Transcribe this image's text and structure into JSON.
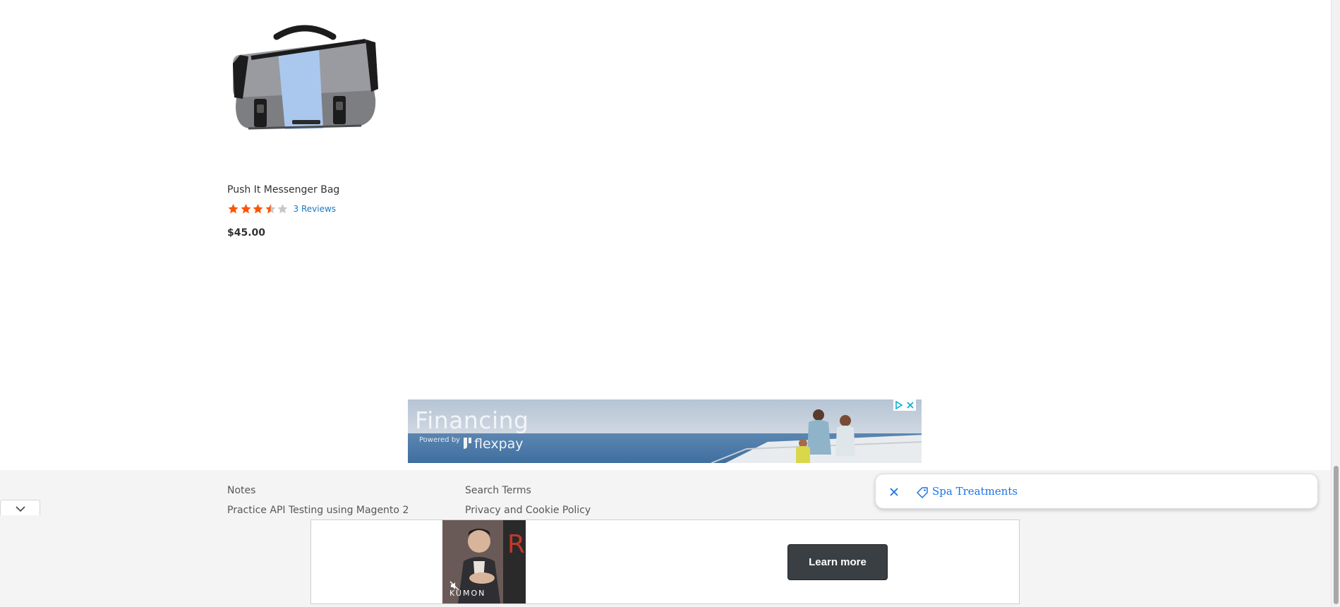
{
  "product": {
    "name": "Push It Messenger Bag",
    "rating": 3.5,
    "rating_max": 5,
    "reviews_label": "3 Reviews",
    "price": "$45.00"
  },
  "banner_ad": {
    "title": "Financing",
    "powered_by": "Powered by",
    "brand": "flexpay"
  },
  "footer": {
    "links": [
      "Notes",
      "Practice API Testing using Magento 2",
      "Search Terms",
      "Privacy and Cookie Policy"
    ]
  },
  "notification": {
    "label": "Spa Treatments"
  },
  "bottom_ad": {
    "video_brand": "KUMON",
    "cta_label": "Learn more"
  },
  "colors": {
    "star_filled": "#ff5501",
    "star_empty": "#c7c7c7",
    "link": "#1979c3",
    "notification_text": "#1a73e8",
    "cta_bg": "#3a3f44"
  }
}
